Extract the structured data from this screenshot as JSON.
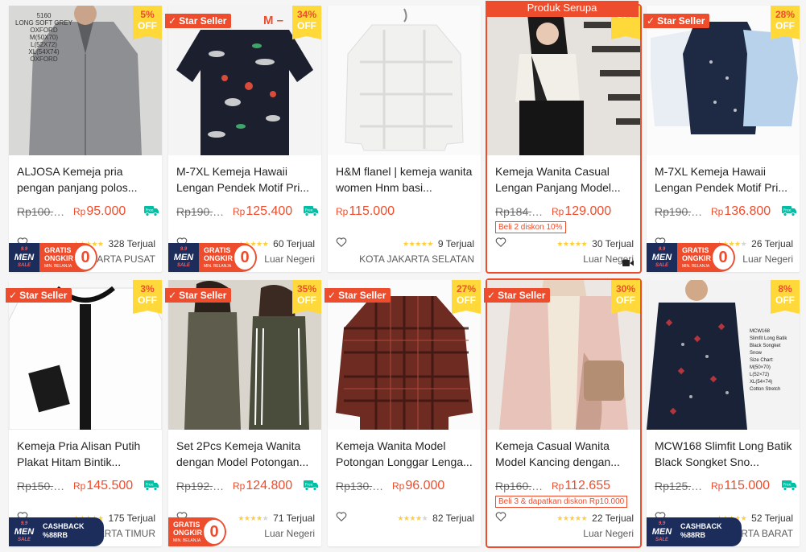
{
  "products": [
    {
      "title": "ALJOSA Kemeja pria pengan panjang polos...",
      "old_price": "Rp100.000",
      "price": "95.000",
      "currency": "Rp",
      "discount_pct": "5%",
      "discount_off": "OFF",
      "star_seller": "",
      "sold": "328 Terjual",
      "rating": 5,
      "location": "KOTA JAKARTA PUSAT",
      "promo": "gratis",
      "image": "grey-shirt",
      "deal": "",
      "video": false,
      "highlight": false,
      "overlay_lines": [
        "5160",
        "LONG SOFT GREY",
        "OXFORD",
        "M(50X70)",
        "L(52X72)",
        "XL(54X74)",
        "OXFORD"
      ]
    },
    {
      "title": "M-7XL Kemeja Hawaii Lengan Pendek Motif Pri...",
      "old_price": "Rp190.0...",
      "price": "125.400",
      "currency": "Rp",
      "discount_pct": "34%",
      "discount_off": "OFF",
      "star_seller": "Star Seller",
      "sold": "60 Terjual",
      "rating": 5,
      "location": "Luar Negeri",
      "promo": "gratis",
      "image": "hawaii-navy",
      "deal": "",
      "video": false,
      "highlight": false,
      "mark": "M –"
    },
    {
      "title": "H&M flanel | kemeja wanita women Hnm basi...",
      "old_price": "",
      "price": "115.000",
      "currency": "Rp",
      "discount_pct": "",
      "discount_off": "",
      "star_seller": "",
      "sold": "9 Terjual",
      "rating": 5,
      "location": "KOTA JAKARTA SELATAN",
      "promo": "",
      "image": "white-flannel",
      "deal": "",
      "video": false,
      "highlight": false
    },
    {
      "title": "Kemeja Wanita Casual Lengan Panjang Model...",
      "old_price": "Rp184.286",
      "price": "129.000",
      "currency": "Rp",
      "discount_pct": "",
      "discount_off": "OFF",
      "star_seller": "",
      "sold": "30 Terjual",
      "rating": 5,
      "location": "Luar Negeri",
      "promo": "",
      "image": "woman-stairs",
      "deal": "Beli 2 diskon 10%",
      "video": true,
      "highlight": true,
      "banner": "Produk Serupa"
    },
    {
      "title": "M-7XL Kemeja Hawaii Lengan Pendek Motif Pri...",
      "old_price": "Rp190.0...",
      "price": "136.800",
      "currency": "Rp",
      "discount_pct": "28%",
      "discount_off": "OFF",
      "star_seller": "Star Seller",
      "sold": "26 Terjual",
      "rating": 4,
      "location": "Luar Negeri",
      "promo": "gratis",
      "image": "three-shirts",
      "deal": "",
      "video": false,
      "highlight": false
    },
    {
      "title": "Kemeja Pria Alisan Putih Plakat Hitam Bintik...",
      "old_price": "Rp150.0...",
      "price": "145.500",
      "currency": "Rp",
      "discount_pct": "3%",
      "discount_off": "OFF",
      "star_seller": "Star Seller",
      "sold": "175 Terjual",
      "rating": 5,
      "location": "KOTA JAKARTA TIMUR",
      "promo": "cashback",
      "image": "white-black-placket",
      "deal": "",
      "video": false,
      "highlight": false
    },
    {
      "title": "Set 2Pcs Kemeja Wanita dengan Model Potongan...",
      "old_price": "Rp192.000",
      "price": "124.800",
      "currency": "Rp",
      "discount_pct": "35%",
      "discount_off": "OFF",
      "star_seller": "Star Seller",
      "sold": "71 Terjual",
      "rating": 4,
      "location": "Luar Negeri",
      "promo": "gratis-only",
      "image": "two-women",
      "deal": "",
      "video": false,
      "highlight": false
    },
    {
      "title": "Kemeja Wanita Model Potongan Longgar Lenga...",
      "old_price": "Rp130.863",
      "price": "96.000",
      "currency": "Rp",
      "discount_pct": "27%",
      "discount_off": "OFF",
      "star_seller": "Star Seller",
      "sold": "82 Terjual",
      "rating": 4,
      "location": "",
      "promo": "",
      "image": "red-plaid",
      "deal": "",
      "video": false,
      "highlight": false
    },
    {
      "title": "Kemeja Casual Wanita Model Kancing dengan...",
      "old_price": "Rp160.937",
      "price": "112.655",
      "currency": "Rp",
      "discount_pct": "30%",
      "discount_off": "OFF",
      "star_seller": "Star Seller",
      "sold": "22 Terjual",
      "rating": 5,
      "location": "Luar Negeri",
      "promo": "",
      "image": "pink-cardigan",
      "deal": "Beli 3 & dapatkan diskon Rp10.000",
      "video": false,
      "highlight": true
    },
    {
      "title": "MCW168 Slimfit Long Batik Black Songket Sno...",
      "old_price": "Rp125.0...",
      "price": "115.000",
      "currency": "Rp",
      "discount_pct": "8%",
      "discount_off": "OFF",
      "star_seller": "",
      "sold": "52 Terjual",
      "rating": 5,
      "location": "KOTA JAKARTA BARAT",
      "promo": "cashback",
      "image": "batik-navy",
      "deal": "",
      "video": false,
      "highlight": false,
      "overlay_lines": [
        "MCW168",
        "Slimfit Long Batik",
        "Black Songket",
        "Snow",
        "Size Chart:",
        "M(50×70)",
        "L(52×72)",
        "XL(54×74)",
        "Cotton Stretch"
      ]
    }
  ],
  "promo_text": {
    "men_line1": "9.9",
    "men_line2": "MEN",
    "men_line3": "SALE",
    "gratis_line1": "GRATIS",
    "gratis_line2": "ONGKIR",
    "gratis_line3": "MIN. BELANJA",
    "gratis_zero": "0",
    "cashback_line1": "CASHBACK",
    "cashback_line2": "%88RB"
  },
  "colors": {
    "accent": "#ee4d2d",
    "discount_bg": "#ffd839",
    "star": "#ffce3d",
    "promo_navy": "#1c2c5b"
  },
  "icons": {
    "heart": "heart-outline-icon",
    "free_shipping": "free-shipping-truck-icon",
    "video": "video-camera-icon",
    "check": "check-icon"
  }
}
